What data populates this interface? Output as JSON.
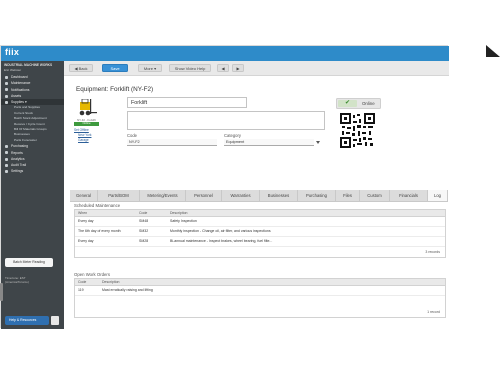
{
  "app": {
    "logo": "fiix"
  },
  "sidebar": {
    "org_name": "INDUSTRIAL MACHINE WORKS",
    "org_sub": "Eric Webster",
    "items": [
      {
        "label": "Dashboard",
        "icon": "dashboard-icon"
      },
      {
        "label": "Maintenance",
        "icon": "wrench-icon"
      },
      {
        "label": "Notifications",
        "icon": "bell-icon"
      },
      {
        "label": "Assets",
        "icon": "box-icon"
      },
      {
        "label": "Supplies ▾",
        "icon": "supplies-icon"
      }
    ],
    "sub_items": [
      "Parts and Supplies",
      "Current Stock",
      "Batch Stock Adjustment",
      "Receive / Cycle Count",
      "Bill Of Materials Groups",
      "Businesses",
      "Parts Forecaster"
    ],
    "items2": [
      {
        "label": "Purchasing",
        "icon": "cart-icon"
      },
      {
        "label": "Reports",
        "icon": "report-icon"
      },
      {
        "label": "Analytics",
        "icon": "chart-icon"
      },
      {
        "label": "Audit Trail",
        "icon": "audit-icon"
      },
      {
        "label": "Settings",
        "icon": "gear-icon"
      }
    ],
    "batch_button": "Batch Meter Reading",
    "timezone_line1": "Timezone: EST",
    "timezone_line2": "(America/Toronto)",
    "help_button": "Help & Resources"
  },
  "toolbar": {
    "back": "◀ Back",
    "save": "Save",
    "more": "More ▾",
    "show_video_help": "Show Video Help",
    "prev": "◀",
    "next": "▶"
  },
  "asset": {
    "title": "Equipment: Forklift (NY-F2)",
    "name_value": "Forklift",
    "photo_caption": "NY-F2 - Forklift",
    "status_bar": "Online",
    "link_set_offline": "Set Offline",
    "link_location": "New York",
    "link_facility": "Garage",
    "online_label": "Online",
    "code_label": "Code",
    "code_value": "NY-F2",
    "category_label": "Category",
    "category_value": "Equipment"
  },
  "tabs": [
    "General",
    "Parts/BOM",
    "Metering/Events",
    "Personnel",
    "Warranties",
    "Businesses",
    "Purchasing",
    "Files",
    "Custom",
    "Financials",
    "Log"
  ],
  "scheduled": {
    "title": "Scheduled Maintenance",
    "headers": [
      "When",
      "Code",
      "Description"
    ],
    "rows": [
      [
        "Every day",
        "SM48",
        "Safety Inspection"
      ],
      [
        "The 6th day of every month",
        "SM32",
        "Monthly inspection - Change oil, air filter, and various inspections"
      ],
      [
        "Every day",
        "SM28",
        "Bi-annual maintenance - Inspect brakes, wheel bearing, fuel filte..."
      ]
    ],
    "records": "3 records"
  },
  "open_orders": {
    "title": "Open Work Orders",
    "headers": [
      "Code",
      "Description"
    ],
    "rows": [
      [
        "119",
        "Mast erratically raising and lifting"
      ]
    ],
    "records": "1 record"
  }
}
